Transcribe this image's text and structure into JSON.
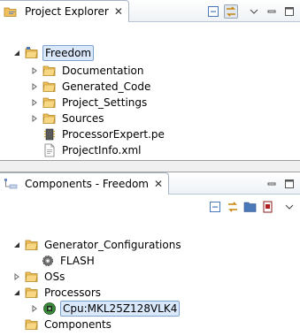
{
  "project_explorer": {
    "title": "Project Explorer",
    "tree": [
      {
        "label": "Freedom",
        "icon": "project-folder-icon",
        "expanded": true
      },
      {
        "label": "Documentation",
        "icon": "folder-icon"
      },
      {
        "label": "Generated_Code",
        "icon": "folder-icon"
      },
      {
        "label": "Project_Settings",
        "icon": "folder-icon"
      },
      {
        "label": "Sources",
        "icon": "folder-icon"
      },
      {
        "label": "ProcessorExpert.pe",
        "icon": "pe-file-icon"
      },
      {
        "label": "ProjectInfo.xml",
        "icon": "xml-file-icon"
      }
    ]
  },
  "components_view": {
    "title": "Components - Freedom",
    "tree": [
      {
        "label": "Generator_Configurations",
        "icon": "folder-icon",
        "expanded": true
      },
      {
        "label": "FLASH",
        "icon": "gear-icon"
      },
      {
        "label": "OSs",
        "icon": "folder-icon"
      },
      {
        "label": "Processors",
        "icon": "folder-icon",
        "expanded": true
      },
      {
        "label": "Cpu:MKL25Z128VLK4",
        "icon": "cpu-chip-icon",
        "selected": true
      },
      {
        "label": "Components",
        "icon": "folder-icon"
      }
    ]
  },
  "colors": {
    "selection_bg": "#d9e8fb",
    "selection_border": "#7da2ce",
    "folder": "#f2c05a"
  }
}
